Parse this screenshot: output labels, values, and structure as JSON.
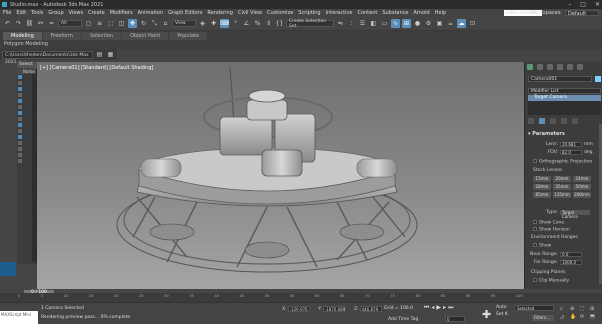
{
  "window": {
    "title": "Studio.max - Autodesk 3ds Max 2021",
    "controls": [
      "–",
      "□",
      "✕"
    ]
  },
  "menu": [
    "File",
    "Edit",
    "Tools",
    "Group",
    "Views",
    "Create",
    "Modifiers",
    "Animation",
    "Graph Editors",
    "Rendering",
    "Civil View",
    "Customize",
    "Scripting",
    "Interactive",
    "Content",
    "Substance",
    "Arnold",
    "Help"
  ],
  "account": {
    "user": "robin beaiso",
    "workspace_label": "Workspaces:",
    "workspace_value": "Default"
  },
  "toolbar": {
    "filter": "All",
    "view": "View",
    "selection_set": "Create Selection Set"
  },
  "ribbon": {
    "tabs": [
      "Modeling",
      "Freeform",
      "Selection",
      "Object Paint",
      "Populate"
    ],
    "active_tab": "Modeling",
    "subtitle": "Polygon Modeling"
  },
  "project": {
    "path": "C:\\Users\\theden\\Documents\\3ds Max 2021"
  },
  "scene_explorer": {
    "tab": "Select",
    "header": "Name"
  },
  "viewport": {
    "label": "[+] [Camera01] [Standard] [Default Shading]"
  },
  "command_panel": {
    "object_name": "Camera001",
    "swatch_color": "#7ad3ff",
    "modifier_list": "Modifier List",
    "stack_item": "Target Camera",
    "parameters_title": "▾ Parameters",
    "lens_label": "Lens:",
    "lens_value": "20.681",
    "lens_unit": "mm",
    "fov_label": "FOV:",
    "fov_value": "82.0",
    "fov_unit": "deg.",
    "ortho": "Orthographic Projection",
    "stock_lenses": "Stock Lenses",
    "lenses": [
      "15mm",
      "20mm",
      "24mm",
      "28mm",
      "35mm",
      "50mm",
      "85mm",
      "135mm",
      "200mm"
    ],
    "type_label": "Type:",
    "type_value": "Target Camera",
    "show_cone": "Show Cone",
    "show_horizon": "Show Horizon",
    "env_ranges": "Environment Ranges",
    "show": "Show",
    "near_label": "Near Range:",
    "near_value": "0.0",
    "far_label": "Far Range:",
    "far_value": "1000.0",
    "clipping": "Clipping Planes",
    "clip_manually": "Clip Manually"
  },
  "timeline": {
    "thumb": "0 / 100",
    "ticks": [
      "0",
      "5",
      "10",
      "15",
      "20",
      "25",
      "30",
      "35",
      "40",
      "45",
      "50",
      "55",
      "60",
      "65",
      "70",
      "75",
      "80",
      "85",
      "90",
      "95",
      "100"
    ]
  },
  "status": {
    "maxscript": "MAXScript Mini",
    "selected": "1 Camera Selected",
    "message": "Rendering preview pass... 0% complete",
    "x_label": "X:",
    "x_value": "-329.976",
    "y_label": "Y:",
    "y_value": "-1870.089",
    "z_label": "Z:",
    "z_value": "446.879",
    "grid": "Grid = 100.0",
    "add_time_tag": "Add Time Tag",
    "frame": "0",
    "auto": "Auto",
    "set_k": "Set K.",
    "selected_dd": "Selected",
    "filters": "Filters..."
  },
  "colors": {
    "accent": "#5b8fb9",
    "viewport_bg": "#898989"
  }
}
